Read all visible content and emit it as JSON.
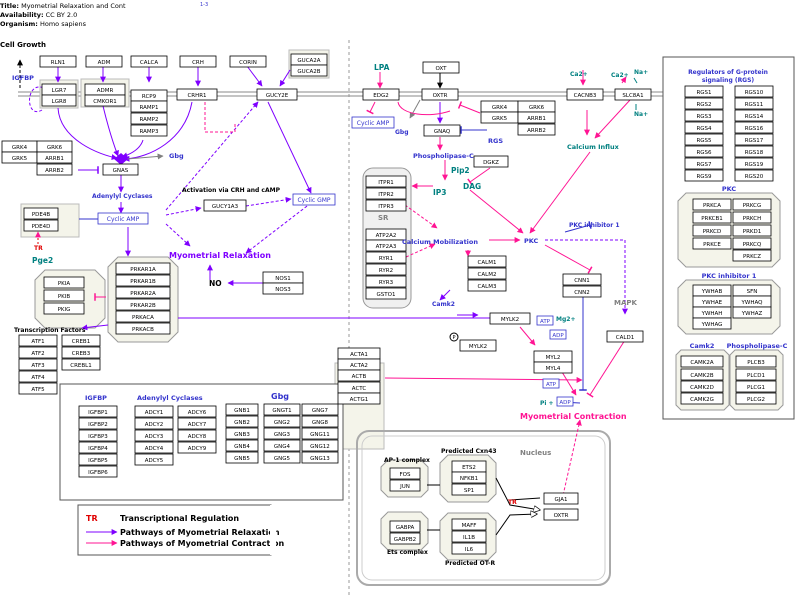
{
  "header": {
    "title_label": "Title:",
    "title_value": "Myometrial Relaxation and Cont",
    "title_ref": "1-3",
    "availability_label": "Availability:",
    "availability_value": "CC BY 2.0",
    "organism_label": "Organism:",
    "organism_value": "Homo sapiens"
  },
  "colors": {
    "relaxation": "#7f00ff",
    "contraction": "#ff1493",
    "transcription": "#e00000",
    "blue_label": "#3333cc",
    "teal_label": "#008080",
    "gray_label": "#808080"
  },
  "labels": {
    "cell_growth": "Cell Growth",
    "igfbp_top": "IGFBP",
    "gbg_mid": "Gbg",
    "adenylyl_cyclases": "Adenylyl Cyclases",
    "cyclic_amp": "Cyclic AMP",
    "activation_crh": "Activation via CRH and cAMP",
    "cyclic_gmp": "Cyclic GMP",
    "myometrial_relaxation": "Myometrial Relaxation",
    "no": "NO",
    "tr_small": "TR",
    "pge2": "Pge2",
    "transcription_factors": "Transcription Factors",
    "lpa": "LPA",
    "cyclic_amp_right": "Cyclic AMP",
    "gbg_right": "Gbg",
    "rgs": "RGS",
    "phospholipase_c": "Phospholipase-C",
    "pip2": "Pip2",
    "ip3": "IP3",
    "dag": "DAG",
    "sr": "SR",
    "calcium_mobilization": "Calcium Mobilization",
    "pkc": "PKC",
    "pkc_inhibitor": "PKC inhibitor 1",
    "camk2_label": "Camk2",
    "atp1": "ATP",
    "adp1": "ADP",
    "mg2": "Mg2+",
    "p": "P",
    "mapk": "MAPK",
    "atp2": "ATP",
    "pi": "Pi +",
    "adp2": "ADP",
    "myometrial_contraction": "Myometrial Contraction",
    "ca_left": "Ca2+",
    "ca_right": "Ca2+",
    "na_top": "Na+",
    "na_bottom": "Na+",
    "calcium_influx": "Calcium Influx",
    "nucleus": "Nucleus",
    "ap1_complex": "AP-1 complex",
    "predicted_cxn43": "Predicted Cxn43",
    "ets_complex": "Ets complex",
    "predicted_otr": "Predicted OT-R",
    "tr_nucleus": "TR"
  },
  "legend": {
    "tr_key": "TR",
    "tr_text": "Transcriptional Regulation",
    "relax_text": "Pathways of Myometrial Relaxation",
    "contract_text": "Pathways of Myometrial Contraction"
  },
  "group_titles": {
    "igfbp": "IGFBP",
    "adenylyl": "Adenylyl",
    "cyclases": "Cyclases",
    "gbg": "Gbg",
    "rgs_title_1": "Regulators of G-protein",
    "rgs_title_2": "signaling (RGS)",
    "pkc": "PKC",
    "pkc_inhibitor": "PKC inhibitor 1",
    "camk2": "Camk2",
    "phospholipase_c": "Phospholipase-C"
  },
  "genes": {
    "RLN1": "RLN1",
    "ADM": "ADM",
    "CALCA": "CALCA",
    "CRH": "CRH",
    "CORIN": "CORIN",
    "GUCA2A": "GUCA2A",
    "GUCA2B": "GUCA2B",
    "LGR7": "LGR7",
    "LGR8": "LGR8",
    "ADMR": "ADMR",
    "CMKOR1": "CMKOR1",
    "RCP9": "RCP9",
    "RAMP1": "RAMP1",
    "RAMP2": "RAMP2",
    "RAMP3": "RAMP3",
    "CRHR1": "CRHR1",
    "GUCY2E": "GUCY2E",
    "GRK4a": "GRK4",
    "GRK6a": "GRK6",
    "GRK5a": "GRK5",
    "ARRB1a": "ARRB1",
    "ARRB2a": "ARRB2",
    "GNAS": "GNAS",
    "PDE4B": "PDE4B",
    "PDE4D": "PDE4D",
    "GUCY1A3": "GUCY1A3",
    "NOS1": "NOS1",
    "NOS3": "NOS3",
    "PKIA": "PKIA",
    "PKIB": "PKIB",
    "PKIG": "PKIG",
    "PRKAR1A": "PRKAR1A",
    "PRKAR1B": "PRKAR1B",
    "PRKAR2A": "PRKAR2A",
    "PRKAR2B": "PRKAR2B",
    "PRKACA": "PRKACA",
    "PRKACB": "PRKACB",
    "ATF1": "ATF1",
    "ATF2": "ATF2",
    "ATF3": "ATF3",
    "ATF4": "ATF4",
    "ATF5": "ATF5",
    "CREB1": "CREB1",
    "CREB3": "CREB3",
    "CREBL1": "CREBL1",
    "OXT": "OXT",
    "EDG2": "EDG2",
    "OXTR": "OXTR",
    "CACNB3": "CACNB3",
    "SLC8A1": "SLC8A1",
    "GRK4b": "GRK4",
    "GRK6b": "GRK6",
    "GRK5b": "GRK5",
    "ARRB1b": "ARRB1",
    "ARRB2b": "ARRB2",
    "GNAQ": "GNAQ",
    "DGKZ": "DGKZ",
    "ITPR1": "ITPR1",
    "ITPR2": "ITPR2",
    "ITPR3": "ITPR3",
    "ATP2A2": "ATP2A2",
    "ATP2A3": "ATP2A3",
    "RYR1": "RYR1",
    "RYR2": "RYR2",
    "RYR3": "RYR3",
    "GSTO1": "GSTO1",
    "CALM1": "CALM1",
    "CALM2": "CALM2",
    "CALM3": "CALM3",
    "CNN1": "CNN1",
    "CNN2": "CNN2",
    "MYLK2a": "MYLK2",
    "MYLK2b": "MYLK2",
    "MYL2": "MYL2",
    "MYL4": "MYL4",
    "CALD1": "CALD1",
    "ACTA1": "ACTA1",
    "ACTA2": "ACTA2",
    "ACTB": "ACTB",
    "ACTC": "ACTC",
    "ACTG1": "ACTG1",
    "FOS": "FOS",
    "JUN": "JUN",
    "ETS2": "ETS2",
    "NFKB1": "NFKB1",
    "SP1": "SP1",
    "GABPA": "GABPA",
    "GABPB2": "GABPB2",
    "MAFF": "MAFF",
    "IL1B": "IL1B",
    "IL6": "IL6",
    "GJA1": "GJA1",
    "OXTR2": "OXTR",
    "IGFBP1": "IGFBP1",
    "IGFBP2": "IGFBP2",
    "IGFBP3": "IGFBP3",
    "IGFBP4": "IGFBP4",
    "IGFBP5": "IGFBP5",
    "IGFBP6": "IGFBP6",
    "ADCY1": "ADCY1",
    "ADCY2": "ADCY2",
    "ADCY3": "ADCY3",
    "ADCY4": "ADCY4",
    "ADCY5": "ADCY5",
    "ADCY6": "ADCY6",
    "ADCY7": "ADCY7",
    "ADCY8": "ADCY8",
    "ADCY9": "ADCY9",
    "GNB1": "GNB1",
    "GNB2": "GNB2",
    "GNB3": "GNB3",
    "GNB4": "GNB4",
    "GNB5": "GNB5",
    "GNGT1": "GNGT1",
    "GNG2": "GNG2",
    "GNG3": "GNG3",
    "GNG4": "GNG4",
    "GNG5": "GNG5",
    "GNG7": "GNG7",
    "GNG8": "GNG8",
    "GNG11": "GNG11",
    "GNG12": "GNG12",
    "GNG13": "GNG13",
    "RGS1": "RGS1",
    "RGS2": "RGS2",
    "RGS3": "RGS3",
    "RGS4": "RGS4",
    "RGS5": "RGS5",
    "RGS6": "RGS6",
    "RGS7": "RGS7",
    "RGS9": "RGS9",
    "RGS10": "RGS10",
    "RGS11": "RGS11",
    "RGS14": "RGS14",
    "RGS16": "RGS16",
    "RGS17": "RGS17",
    "RGS18": "RGS18",
    "RGS19": "RGS19",
    "RGS20": "RGS20",
    "PRKCA": "PRKCA",
    "PRKCB1": "PRKCB1",
    "PRKCD": "PRKCD",
    "PRKCE": "PRKCE",
    "PRKCG": "PRKCG",
    "PRKCH": "PRKCH",
    "PRKD1": "PRKD1",
    "PRKCQ": "PRKCQ",
    "PRKCZ": "PRKCZ",
    "YWHAB": "YWHAB",
    "YWHAE": "YWHAE",
    "YWHAH": "YWHAH",
    "YWHAG": "YWHAG",
    "SFN": "SFN",
    "YWHAQ": "YWHAQ",
    "YWHAZ": "YWHAZ",
    "CAMK2A": "CAMK2A",
    "CAMK2B": "CAMK2B",
    "CAMK2D": "CAMK2D",
    "CAMK2G": "CAMK2G",
    "PLCB3": "PLCB3",
    "PLCD1": "PLCD1",
    "PLCG1": "PLCG1",
    "PLCG2": "PLCG2"
  }
}
